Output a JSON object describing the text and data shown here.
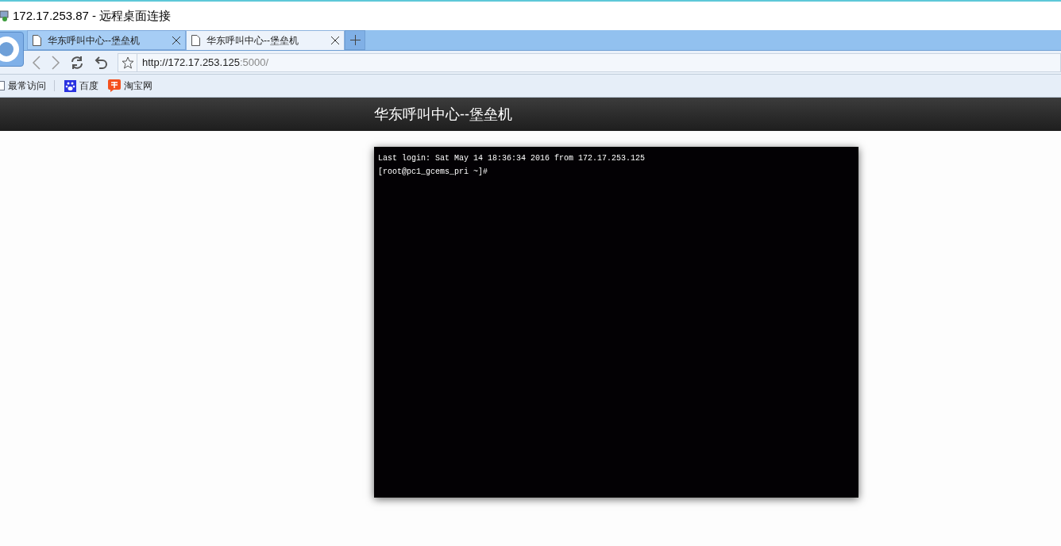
{
  "window": {
    "title": "172.17.253.87 - 远程桌面连接"
  },
  "tabs": [
    {
      "label": "华东呼叫中心--堡垒机",
      "selected": false
    },
    {
      "label": "华东呼叫中心--堡垒机",
      "selected": true
    }
  ],
  "address_bar": {
    "host": "http://172.17.253.125",
    "path": ":5000/"
  },
  "bookmarks": [
    {
      "label": "最常访问",
      "kind": "folder"
    },
    {
      "label": "百度",
      "kind": "paw"
    },
    {
      "label": "淘宝网",
      "kind": "tao"
    }
  ],
  "page": {
    "title": "华东呼叫中心--堡垒机"
  },
  "terminal": {
    "lines": [
      "Last login: Sat May 14 18:36:34 2016 from 172.17.253.125",
      "[root@pc1_gcems_pri ~]#"
    ]
  }
}
